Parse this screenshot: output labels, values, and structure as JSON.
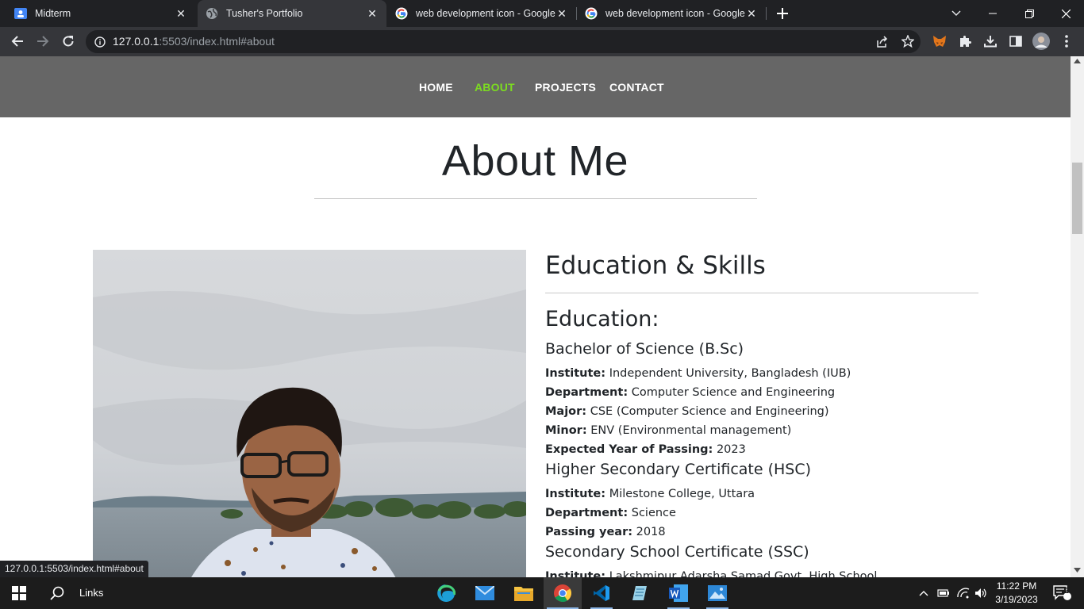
{
  "browser": {
    "tabs": [
      {
        "title": "Midterm",
        "icon": "classroom-icon",
        "active": false
      },
      {
        "title": "Tusher's Portfolio",
        "icon": "globe-icon",
        "active": true
      },
      {
        "title": "web development icon - Google",
        "icon": "google-icon",
        "active": false
      },
      {
        "title": "web development icon - Google",
        "icon": "google-icon",
        "active": false
      }
    ],
    "url_host": "127.0.0.1",
    "url_rest": ":5503/index.html#about",
    "status_url": "127.0.0.1:5503/index.html#about"
  },
  "site": {
    "nav": {
      "home": "HOME",
      "about": "ABOUT",
      "projects": "PROJECTS",
      "contact": "CONTACT",
      "active_color": "#7cdc20"
    },
    "about_title": "About Me",
    "edu_title": "Education & Skills",
    "edu_subtitle": "Education:",
    "bsc": {
      "heading": "Bachelor of Science (B.Sc)",
      "institute_label": "Institute:",
      "institute": "Independent University, Bangladesh (IUB)",
      "department_label": "Department:",
      "department": "Computer Science and Engineering",
      "major_label": "Major:",
      "major": "CSE (Computer Science and Engineering)",
      "minor_label": "Minor:",
      "minor": "ENV (Environmental management)",
      "year_label": "Expected Year of Passing:",
      "year": "2023"
    },
    "hsc": {
      "heading": "Higher Secondary Certificate (HSC)",
      "institute_label": "Institute:",
      "institute": "Milestone College, Uttara",
      "department_label": "Department:",
      "department": "Science",
      "year_label": "Passing year:",
      "year": "2018"
    },
    "ssc": {
      "heading": "Secondary School Certificate (SSC)",
      "institute_label": "Institute:",
      "institute": "Lakshmipur Adarsha Samad Govt. High School"
    }
  },
  "taskbar": {
    "search_label": "Links",
    "time": "11:22 PM",
    "date": "3/19/2023",
    "notification_count": "2"
  }
}
